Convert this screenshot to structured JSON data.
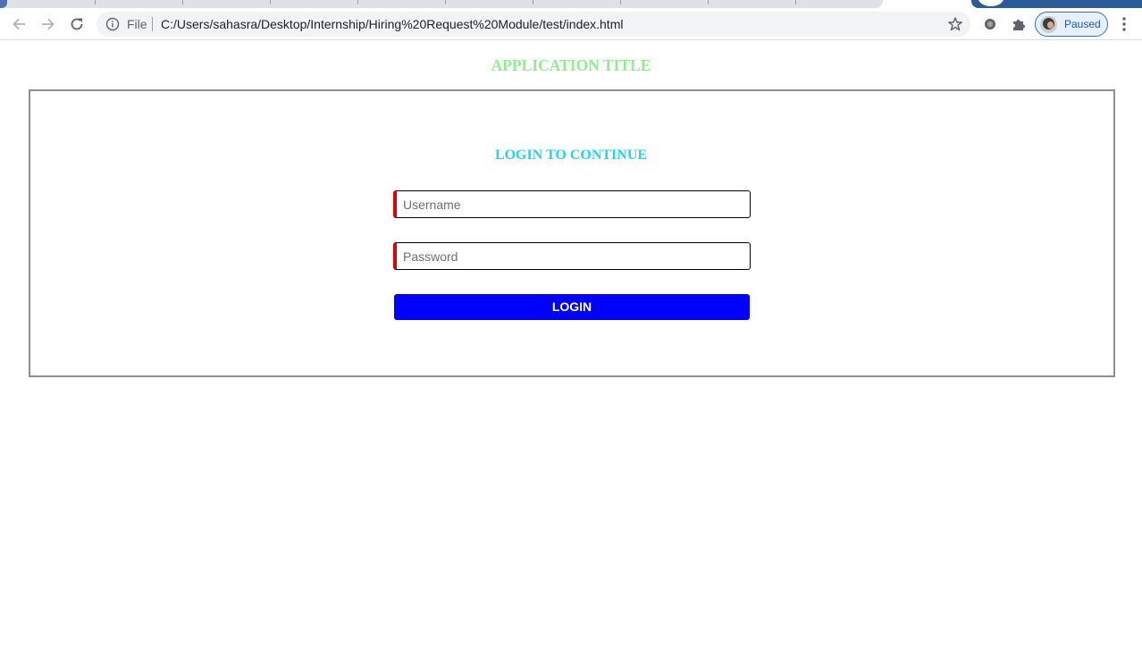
{
  "browser": {
    "file_label": "File",
    "url": "C:/Users/sahasra/Desktop/Internship/Hiring%20Request%20Module/test/index.html",
    "profile_status": "Paused",
    "icons": [
      "back-arrow-icon",
      "forward-arrow-icon",
      "reload-icon",
      "info-icon",
      "star-icon",
      "extension-circle-icon",
      "puzzle-icon",
      "avatar",
      "kebab-menu-icon"
    ]
  },
  "page": {
    "app_title": "APPLICATION TITLE",
    "login_heading": "LOGIN TO CONTINUE",
    "username_placeholder": "Username",
    "password_placeholder": "Password",
    "login_button": "LOGIN"
  },
  "colors": {
    "app_title": "#90ee90",
    "login_heading": "#1ed8e8",
    "login_button_bg": "#0000ff",
    "field_accent": "#e00000",
    "box_border": "#8e8e8e"
  }
}
